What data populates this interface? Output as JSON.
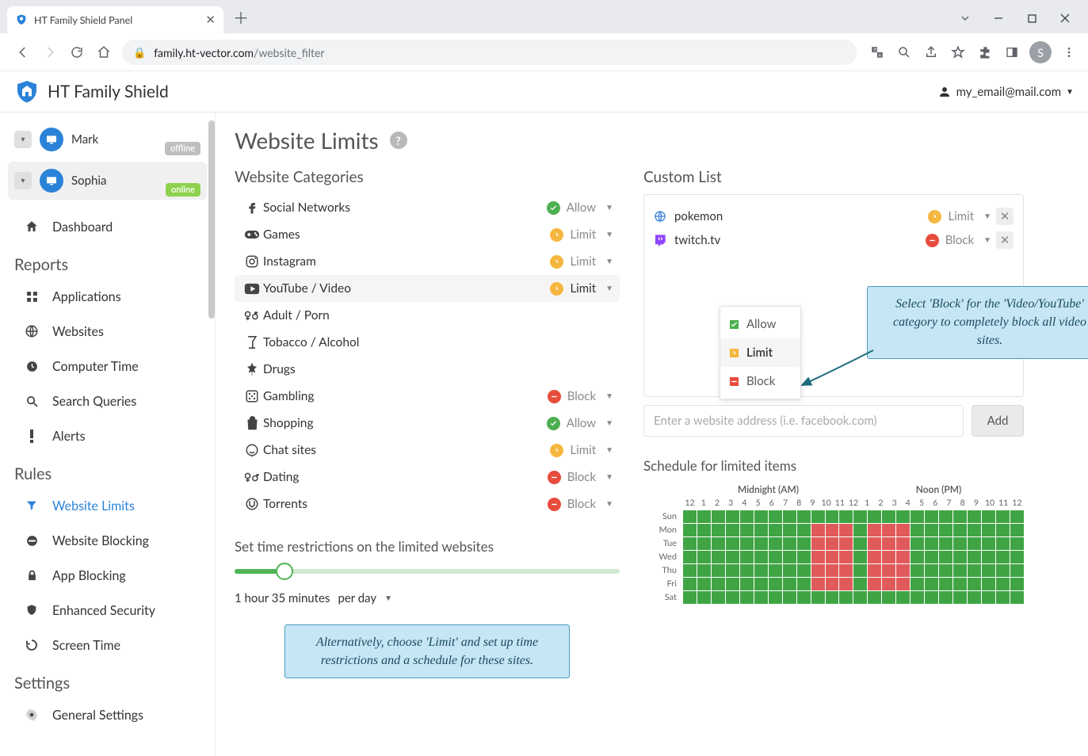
{
  "browser": {
    "tab_title": "HT Family Shield Panel",
    "url_host": "family.ht-vector.com",
    "url_path": "/website_filter",
    "avatar_letter": "S"
  },
  "app": {
    "title": "HT Family Shield",
    "user_email": "my_email@mail.com"
  },
  "profiles": [
    {
      "name": "Mark",
      "status": "offline",
      "selected": false
    },
    {
      "name": "Sophia",
      "status": "online",
      "selected": true
    }
  ],
  "sidebar": {
    "dashboard": "Dashboard",
    "sections": {
      "reports": "Reports",
      "rules": "Rules",
      "settings": "Settings"
    },
    "reports": [
      "Applications",
      "Websites",
      "Computer Time",
      "Search Queries",
      "Alerts"
    ],
    "rules": [
      "Website Limits",
      "Website Blocking",
      "App Blocking",
      "Enhanced Security",
      "Screen Time"
    ],
    "settings": [
      "General Settings"
    ],
    "active": "Website Limits"
  },
  "page": {
    "title": "Website Limits",
    "categories_title": "Website Categories",
    "custom_title": "Custom List",
    "time_title": "Set time restrictions on the limited websites",
    "schedule_title": "Schedule for limited items"
  },
  "categories": [
    {
      "icon": "facebook",
      "name": "Social Networks",
      "status": "Allow"
    },
    {
      "icon": "game",
      "name": "Games",
      "status": "Limit"
    },
    {
      "icon": "instagram",
      "name": "Instagram",
      "status": "Limit"
    },
    {
      "icon": "youtube",
      "name": "YouTube / Video",
      "status": "Limit",
      "open": true
    },
    {
      "icon": "adult",
      "name": "Adult / Porn",
      "status": ""
    },
    {
      "icon": "alcohol",
      "name": "Tobacco / Alcohol",
      "status": ""
    },
    {
      "icon": "drugs",
      "name": "Drugs",
      "status": ""
    },
    {
      "icon": "gambling",
      "name": "Gambling",
      "status": "Block"
    },
    {
      "icon": "shop",
      "name": "Shopping",
      "status": "Allow"
    },
    {
      "icon": "chat",
      "name": "Chat sites",
      "status": "Limit"
    },
    {
      "icon": "dating",
      "name": "Dating",
      "status": "Block"
    },
    {
      "icon": "torrent",
      "name": "Torrents",
      "status": "Block"
    }
  ],
  "dropdown": {
    "items": [
      "Allow",
      "Limit",
      "Block"
    ],
    "selected": "Limit"
  },
  "custom_list": [
    {
      "icon": "globe",
      "site": "pokemon",
      "status": "Limit"
    },
    {
      "icon": "twitch",
      "site": "twitch.tv",
      "status": "Block"
    }
  ],
  "custom_placeholder": "Enter a website address (i.e. facebook.com)",
  "add_label": "Add",
  "time": {
    "value": "1 hour 35 minutes",
    "per": "per day"
  },
  "callouts": {
    "c1": "Select 'Block' for the 'Video/YouTube' category to completely block all video sites.",
    "c2": "Alternatively, choose 'Limit' and set up time restrictions and a schedule for these sites."
  },
  "schedule": {
    "head_mid": "Midnight (AM)",
    "head_noon": "Noon (PM)",
    "hours": [
      "12",
      "1",
      "2",
      "3",
      "4",
      "5",
      "6",
      "7",
      "8",
      "9",
      "10",
      "11",
      "12",
      "1",
      "2",
      "3",
      "4",
      "5",
      "6",
      "7",
      "8",
      "9",
      "10",
      "11",
      "12"
    ],
    "days": [
      "Sun",
      "Mon",
      "Tue",
      "Wed",
      "Thu",
      "Fri",
      "Sat"
    ],
    "blocked": {
      "Sun": [],
      "Sat": [],
      "Mon": [
        9,
        10,
        11,
        13,
        14,
        15
      ],
      "Tue": [
        9,
        10,
        11,
        13,
        14,
        15
      ],
      "Wed": [
        9,
        10,
        11,
        13,
        14,
        15
      ],
      "Thu": [
        9,
        10,
        11,
        13,
        14,
        15
      ],
      "Fri": [
        9,
        10,
        11,
        13,
        14,
        15
      ]
    }
  }
}
